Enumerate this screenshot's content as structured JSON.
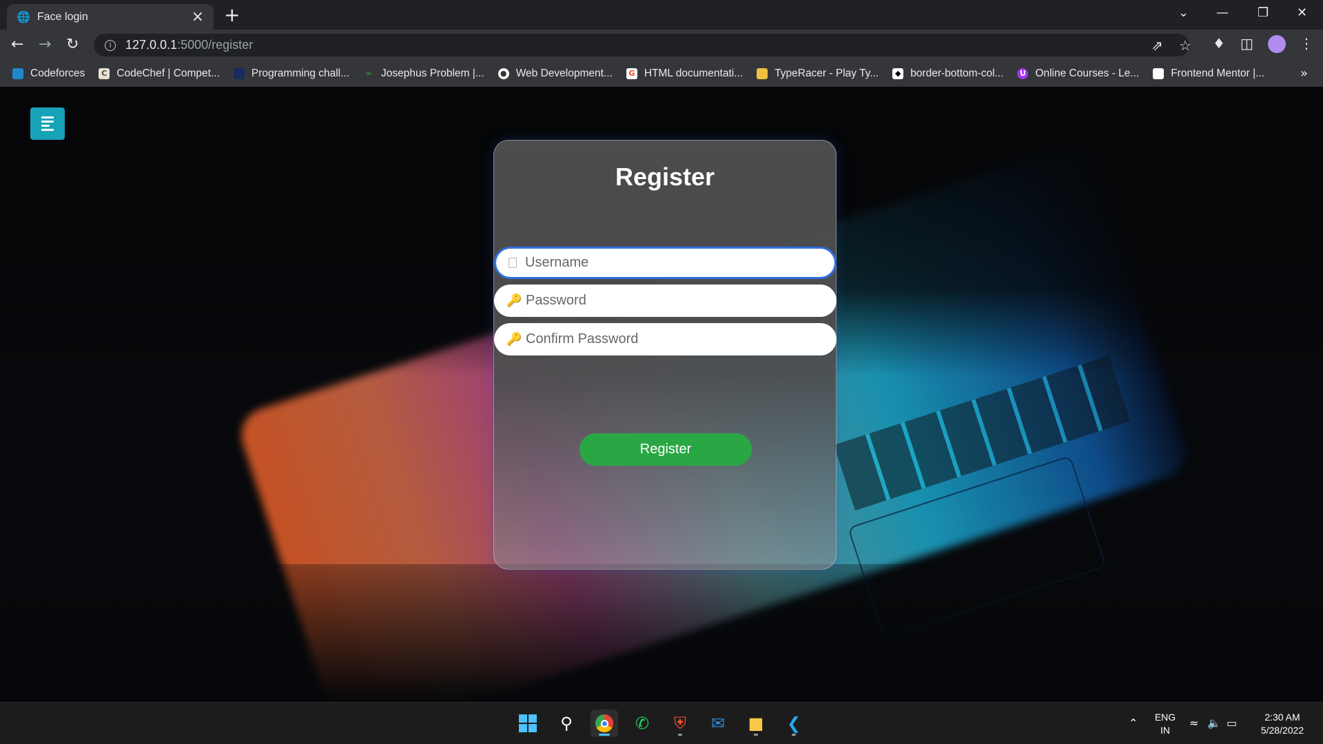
{
  "browser": {
    "tab_title": "Face login",
    "url_host": "127.0.0.1",
    "url_path": ":5000/register",
    "bookmarks": [
      {
        "label": "Codeforces",
        "icon": "codeforces-icon",
        "color": "#1f8acb"
      },
      {
        "label": "CodeChef | Compet...",
        "icon": "codechef-icon",
        "color": "#e8e2d6"
      },
      {
        "label": "Programming chall...",
        "icon": "hackerrank-icon",
        "color": "#1a2a5c"
      },
      {
        "label": "Josephus Problem |...",
        "icon": "geeksforgeeks-icon",
        "color": "#2f8d46"
      },
      {
        "label": "Web Development...",
        "icon": "web-dev-icon",
        "color": "#ffffff"
      },
      {
        "label": "HTML documentati...",
        "icon": "html-doc-icon",
        "color": "#e44d26"
      },
      {
        "label": "TypeRacer - Play Ty...",
        "icon": "typeracer-icon",
        "color": "#f0c040"
      },
      {
        "label": "border-bottom-col...",
        "icon": "codepen-icon",
        "color": "#ffffff"
      },
      {
        "label": "Online Courses - Le...",
        "icon": "udemy-icon",
        "color": "#a435f0"
      },
      {
        "label": "Frontend Mentor |...",
        "icon": "frontend-mentor-icon",
        "color": "#ffffff"
      }
    ]
  },
  "page": {
    "form_title": "Register",
    "username_placeholder": "Username",
    "password_placeholder": "Password",
    "confirm_placeholder": "Confirm Password",
    "submit_label": "Register",
    "colors": {
      "menu_button": "#17a2b8",
      "submit_button": "#2aa745",
      "focus_border": "#2f6fe0"
    }
  },
  "taskbar": {
    "apps": [
      "windows-start-icon",
      "search-icon",
      "chrome-icon",
      "whatsapp-icon",
      "brave-icon",
      "mail-icon",
      "file-explorer-icon",
      "vscode-icon"
    ],
    "language_line1": "ENG",
    "language_line2": "IN",
    "time": "2:30 AM",
    "date": "5/28/2022"
  }
}
